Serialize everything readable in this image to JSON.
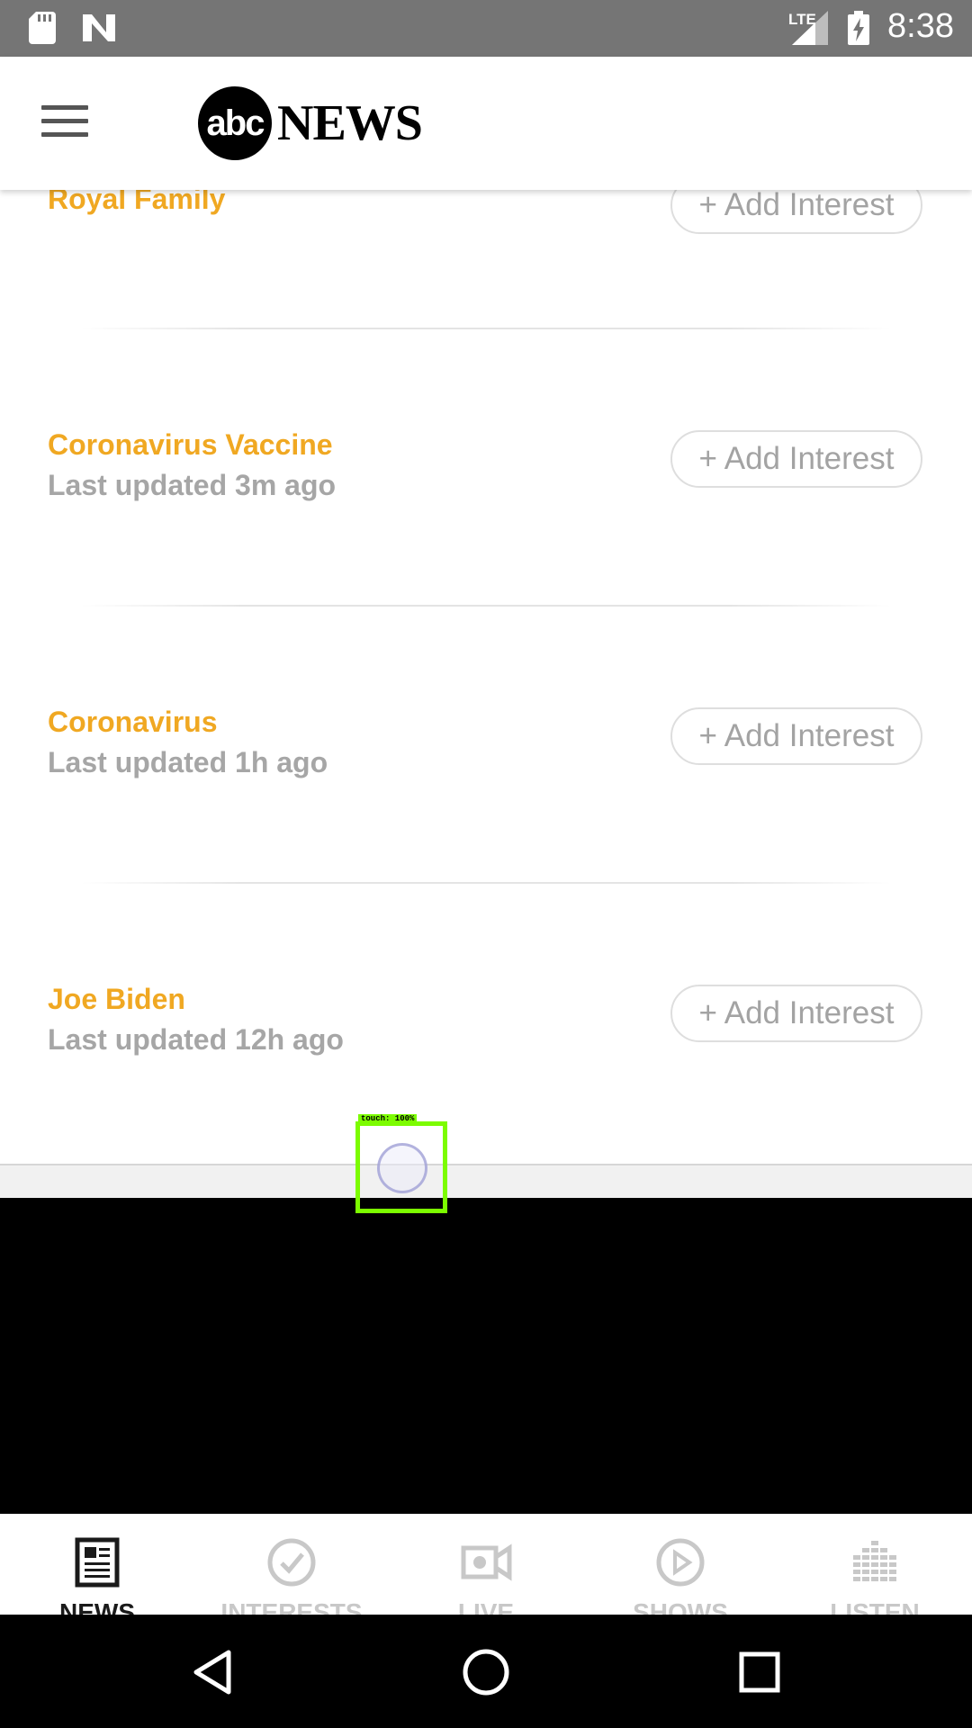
{
  "status_bar": {
    "network": "LTE",
    "time": "8:38",
    "icons": [
      "sd-card-icon",
      "n-logo-icon",
      "signal-icon",
      "battery-charging-icon"
    ]
  },
  "app_bar": {
    "menu_icon": "hamburger-icon",
    "logo_abc": "abc",
    "logo_news": "NEWS"
  },
  "topics": [
    {
      "title": "Royal Family",
      "subtitle": "",
      "button": "+ Add Interest"
    },
    {
      "title": "Coronavirus Vaccine",
      "subtitle": "Last updated 3m ago",
      "button": "+ Add Interest"
    },
    {
      "title": "Coronavirus",
      "subtitle": "Last updated 1h ago",
      "button": "+ Add Interest"
    },
    {
      "title": "Joe Biden",
      "subtitle": "Last updated 12h ago",
      "button": "+ Add Interest"
    }
  ],
  "touch_indicator": {
    "label": "touch: 100%"
  },
  "tabs": [
    {
      "label": "NEWS",
      "icon": "newspaper-icon",
      "active": true
    },
    {
      "label": "INTERESTS",
      "icon": "check-circle-icon",
      "active": false
    },
    {
      "label": "LIVE",
      "icon": "video-camera-icon",
      "active": false
    },
    {
      "label": "SHOWS",
      "icon": "play-circle-icon",
      "active": false
    },
    {
      "label": "LISTEN",
      "icon": "equalizer-icon",
      "active": false
    }
  ],
  "nav_bar": {
    "icons": [
      "back-icon",
      "home-icon",
      "recents-icon"
    ]
  },
  "colors": {
    "topic_title": "#f0a822",
    "subtitle": "#a6a6a6",
    "status_bar": "#757575"
  }
}
